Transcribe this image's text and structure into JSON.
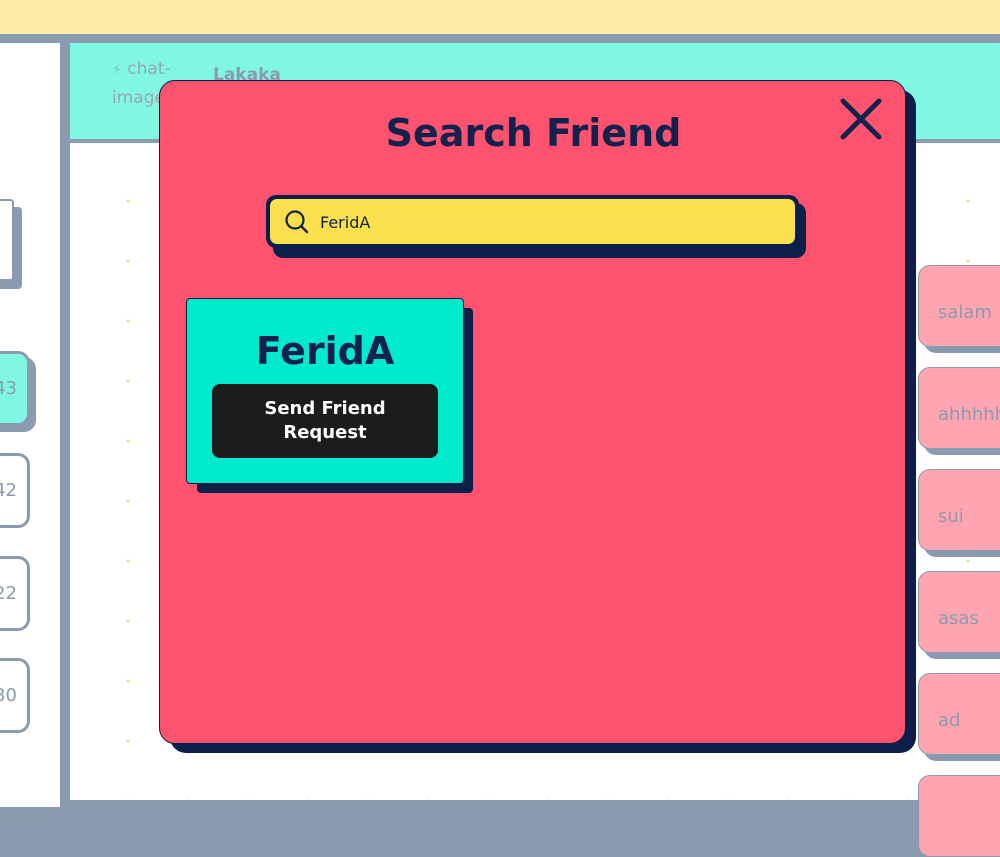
{
  "chat_header": {
    "image_alt": "chat-image",
    "contact_name": "Lakaka"
  },
  "conversation_list": [
    {
      "time": "43",
      "active": true
    },
    {
      "time": "42",
      "active": false
    },
    {
      "time": "22",
      "active": false
    },
    {
      "time": "30",
      "active": false
    }
  ],
  "messages": [
    "salam",
    "ahhhhhh",
    "sui",
    "asas",
    "ad"
  ],
  "modal": {
    "title": "Search Friend",
    "search": {
      "value": "FeridA"
    },
    "results": [
      {
        "name": "FeridA",
        "action_label": "Send Friend Request"
      }
    ]
  },
  "colors": {
    "modal_bg": "#fe536f",
    "search_bg": "#fbe04d",
    "result_bg": "#00ebcd",
    "header_bg": "#80f7e2",
    "navy": "#13224d"
  }
}
